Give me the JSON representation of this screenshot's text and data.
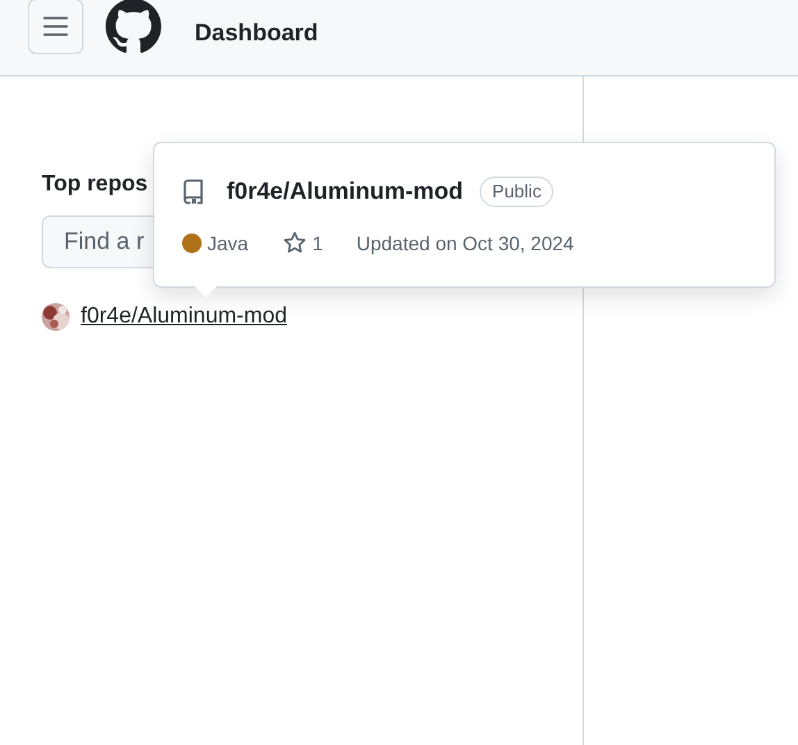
{
  "header": {
    "title": "Dashboard"
  },
  "sidebar": {
    "heading": "Top repos",
    "search": {
      "placeholder": "Find a r"
    },
    "repos": [
      {
        "name": "f0r4e/Aluminum-mod"
      }
    ]
  },
  "hovercard": {
    "name": "f0r4e/Aluminum-mod",
    "visibility": "Public",
    "language": "Java",
    "color": "#b07219",
    "stars": "1",
    "updated": "Updated on Oct 30, 2024"
  }
}
